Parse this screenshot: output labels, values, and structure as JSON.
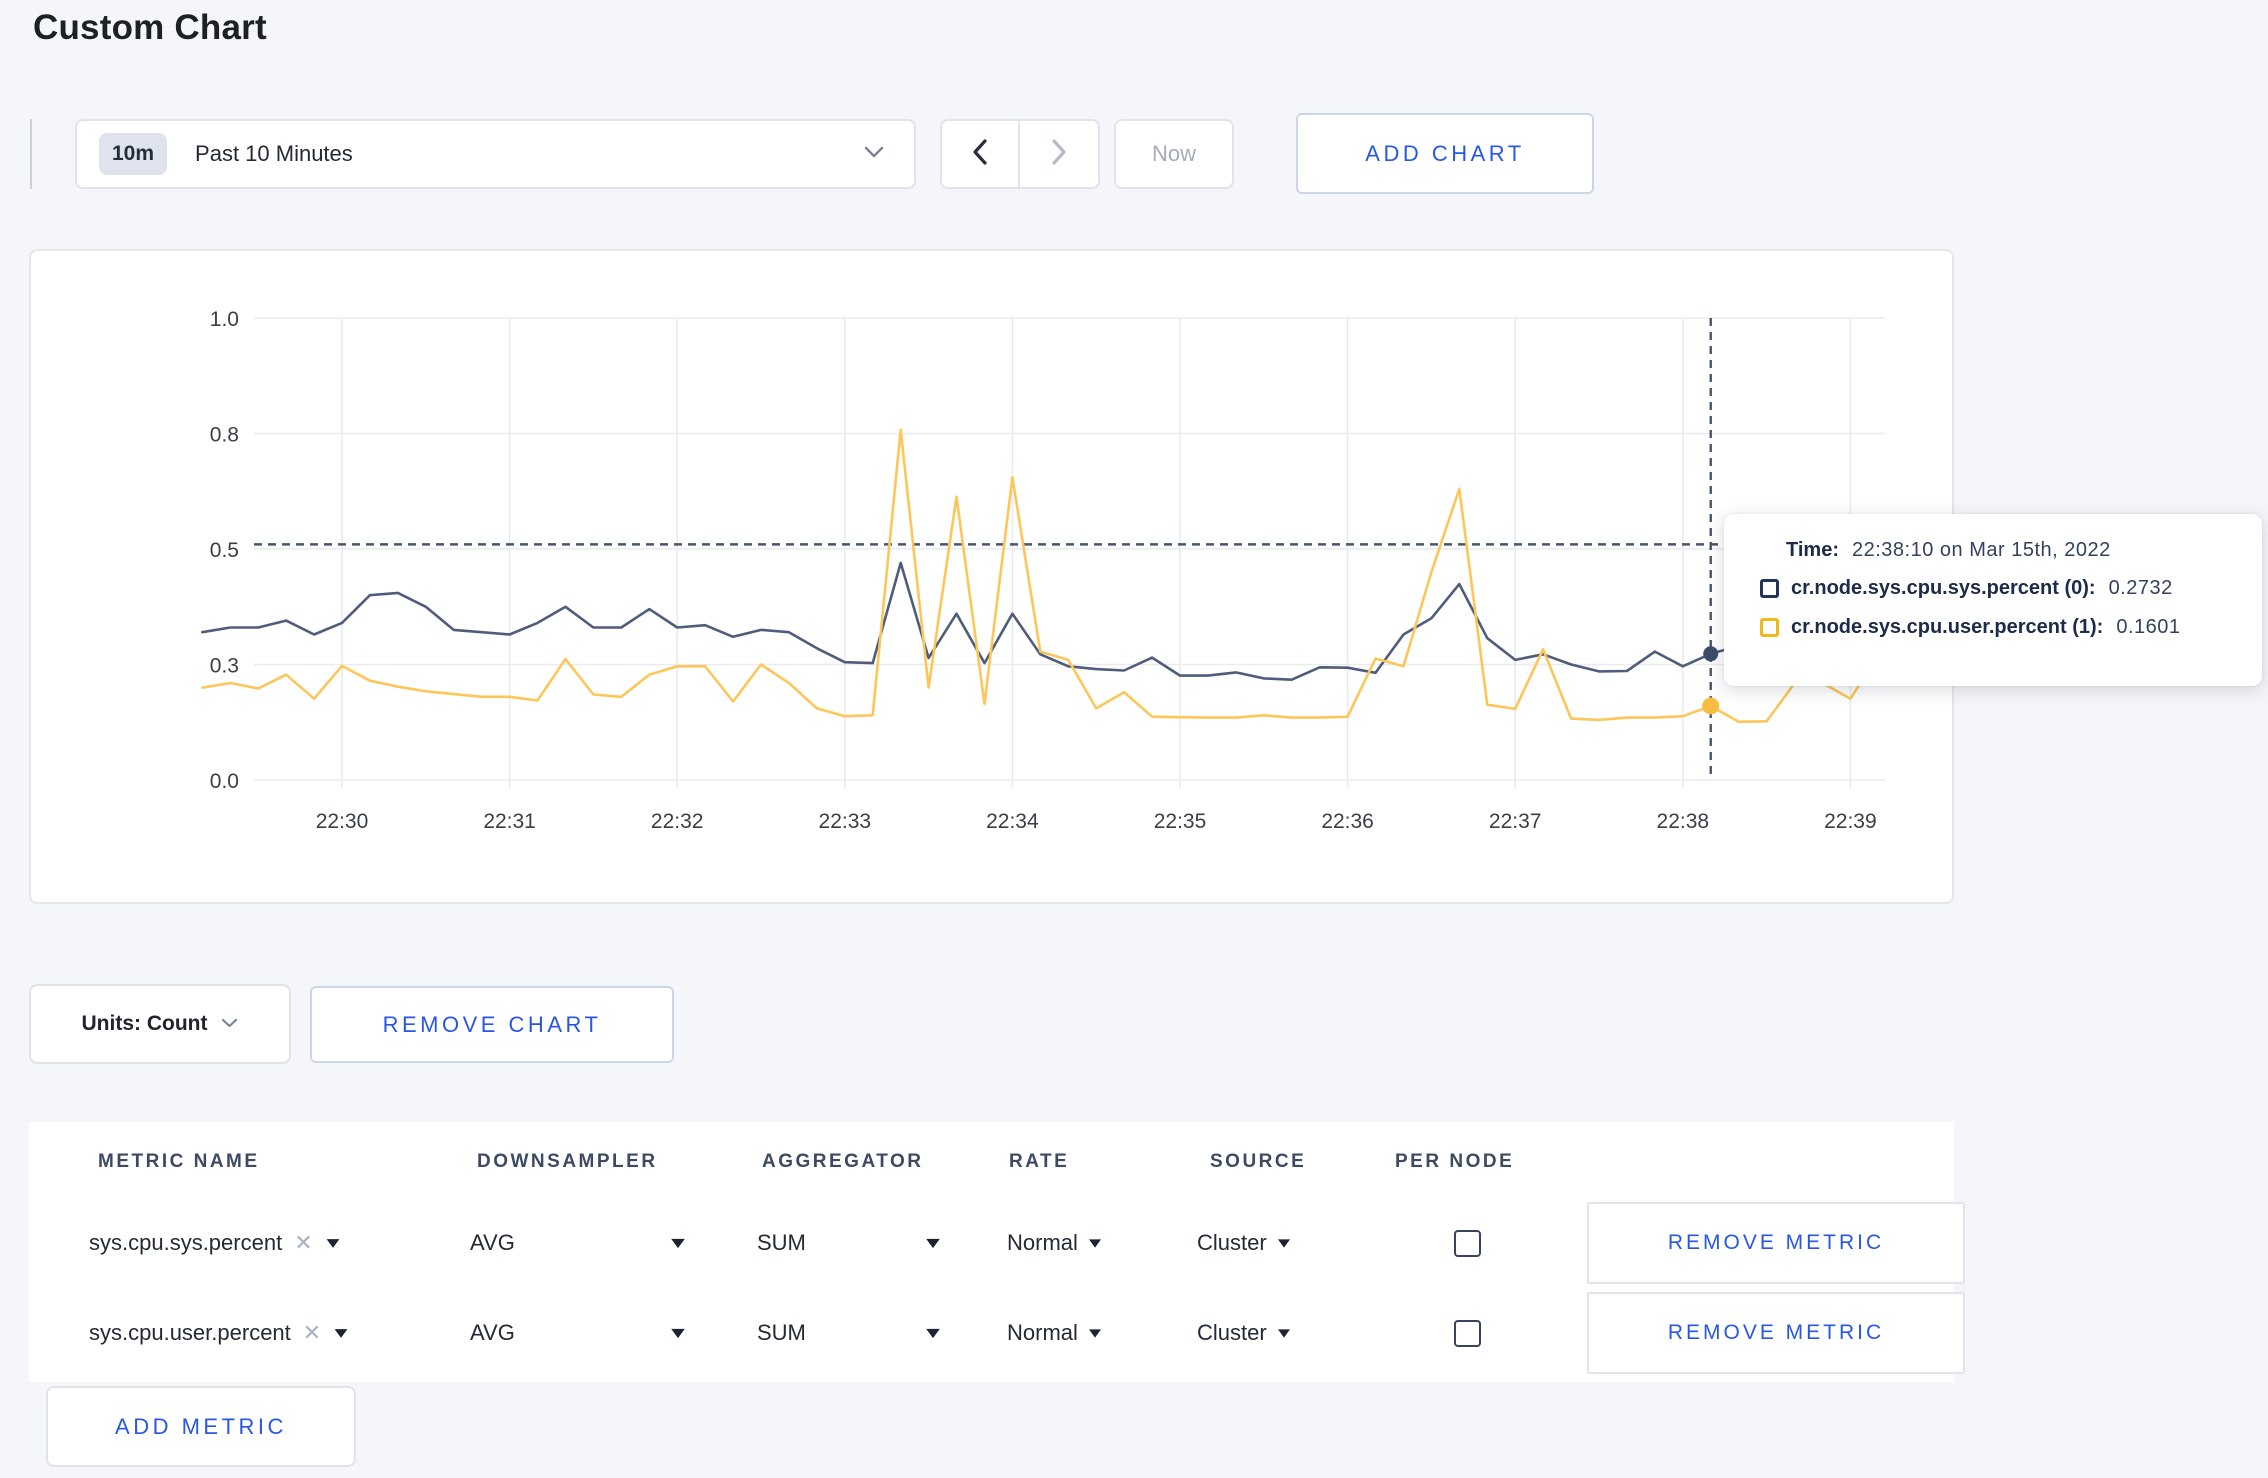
{
  "page": {
    "title": "Custom Chart",
    "background": "#f5f6f9"
  },
  "toolbar": {
    "time_window_badge": "10m",
    "time_window_label": "Past 10 Minutes",
    "now_label": "Now",
    "add_chart_label": "ADD CHART"
  },
  "chart_footer": {
    "units_label": "Units: Count",
    "remove_chart_label": "REMOVE CHART"
  },
  "tooltip": {
    "time_label": "Time:",
    "time_value": "22:38:10 on Mar 15th, 2022",
    "entries": [
      {
        "label": "cr.node.sys.cpu.sys.percent (0):",
        "value": "0.2732",
        "color": "#233557"
      },
      {
        "label": "cr.node.sys.cpu.user.percent (1):",
        "value": "0.1601",
        "color": "#f2b818"
      }
    ]
  },
  "chart_data": {
    "type": "line",
    "title": "",
    "xlabel": "",
    "ylabel": "",
    "ylim": [
      0,
      1
    ],
    "grid": true,
    "legend_position": "tooltip-overlay",
    "y_tick_values": [
      0,
      0.25,
      0.5,
      0.75,
      1.0
    ],
    "y_tick_labels": [
      "0.0",
      "0.3",
      "0.5",
      "0.8",
      "1.0"
    ],
    "x_tick_labels": [
      "22:30",
      "22:31",
      "22:32",
      "22:33",
      "22:34",
      "22:35",
      "22:36",
      "22:37",
      "22:38",
      "22:39"
    ],
    "sample_interval_seconds": 10,
    "times": [
      "22:29:10",
      "22:29:20",
      "22:29:30",
      "22:29:40",
      "22:29:50",
      "22:30:00",
      "22:30:10",
      "22:30:20",
      "22:30:30",
      "22:30:40",
      "22:30:50",
      "22:31:00",
      "22:31:10",
      "22:31:20",
      "22:31:30",
      "22:31:40",
      "22:31:50",
      "22:32:00",
      "22:32:10",
      "22:32:20",
      "22:32:30",
      "22:32:40",
      "22:32:50",
      "22:33:00",
      "22:33:10",
      "22:33:20",
      "22:33:30",
      "22:33:40",
      "22:33:50",
      "22:34:00",
      "22:34:10",
      "22:34:20",
      "22:34:30",
      "22:34:40",
      "22:34:50",
      "22:35:00",
      "22:35:10",
      "22:35:20",
      "22:35:30",
      "22:35:40",
      "22:35:50",
      "22:36:00",
      "22:36:10",
      "22:36:20",
      "22:36:30",
      "22:36:40",
      "22:36:50",
      "22:37:00",
      "22:37:10",
      "22:37:20",
      "22:37:30",
      "22:37:40",
      "22:37:50",
      "22:38:00",
      "22:38:10",
      "22:38:20",
      "22:38:30",
      "22:38:40",
      "22:38:50",
      "22:39:00",
      "22:39:10"
    ],
    "series": [
      {
        "name": "cr.node.sys.cpu.sys.percent (0)",
        "color": "#4f5d7c",
        "values": [
          0.32,
          0.33,
          0.33,
          0.345,
          0.315,
          0.34,
          0.4,
          0.405,
          0.375,
          0.325,
          0.32,
          0.315,
          0.34,
          0.375,
          0.33,
          0.33,
          0.37,
          0.33,
          0.335,
          0.31,
          0.325,
          0.32,
          0.285,
          0.255,
          0.253,
          0.47,
          0.264,
          0.36,
          0.253,
          0.36,
          0.272,
          0.246,
          0.24,
          0.237,
          0.265,
          0.226,
          0.226,
          0.233,
          0.22,
          0.217,
          0.244,
          0.243,
          0.232,
          0.315,
          0.35,
          0.424,
          0.307,
          0.26,
          0.272,
          0.25,
          0.235,
          0.236,
          0.278,
          0.246,
          0.2732,
          0.29,
          0.3,
          0.295,
          0.31,
          0.3,
          0.305
        ]
      },
      {
        "name": "cr.node.sys.cpu.user.percent (1)",
        "color": "#fcc659",
        "values": [
          0.2,
          0.21,
          0.198,
          0.228,
          0.176,
          0.247,
          0.215,
          0.202,
          0.192,
          0.186,
          0.18,
          0.18,
          0.172,
          0.262,
          0.185,
          0.18,
          0.228,
          0.246,
          0.246,
          0.17,
          0.25,
          0.21,
          0.155,
          0.138,
          0.14,
          0.758,
          0.2,
          0.613,
          0.165,
          0.655,
          0.278,
          0.26,
          0.155,
          0.19,
          0.137,
          0.136,
          0.135,
          0.135,
          0.14,
          0.135,
          0.135,
          0.137,
          0.263,
          0.246,
          0.45,
          0.63,
          0.163,
          0.154,
          0.283,
          0.133,
          0.13,
          0.135,
          0.135,
          0.138,
          0.1601,
          0.126,
          0.127,
          0.209,
          0.21,
          0.176,
          0.27
        ]
      }
    ],
    "crosshair": {
      "time": "22:38:10",
      "y_value": 0.51
    }
  },
  "metrics_table": {
    "headers": [
      "METRIC NAME",
      "DOWNSAMPLER",
      "AGGREGATOR",
      "RATE",
      "SOURCE",
      "PER NODE"
    ],
    "rows": [
      {
        "metric": "sys.cpu.sys.percent",
        "downsampler": "AVG",
        "aggregator": "SUM",
        "rate": "Normal",
        "source": "Cluster",
        "per_node": false,
        "remove_label": "REMOVE METRIC"
      },
      {
        "metric": "sys.cpu.user.percent",
        "downsampler": "AVG",
        "aggregator": "SUM",
        "rate": "Normal",
        "source": "Cluster",
        "per_node": false,
        "remove_label": "REMOVE METRIC"
      }
    ],
    "add_metric_label": "ADD METRIC"
  }
}
